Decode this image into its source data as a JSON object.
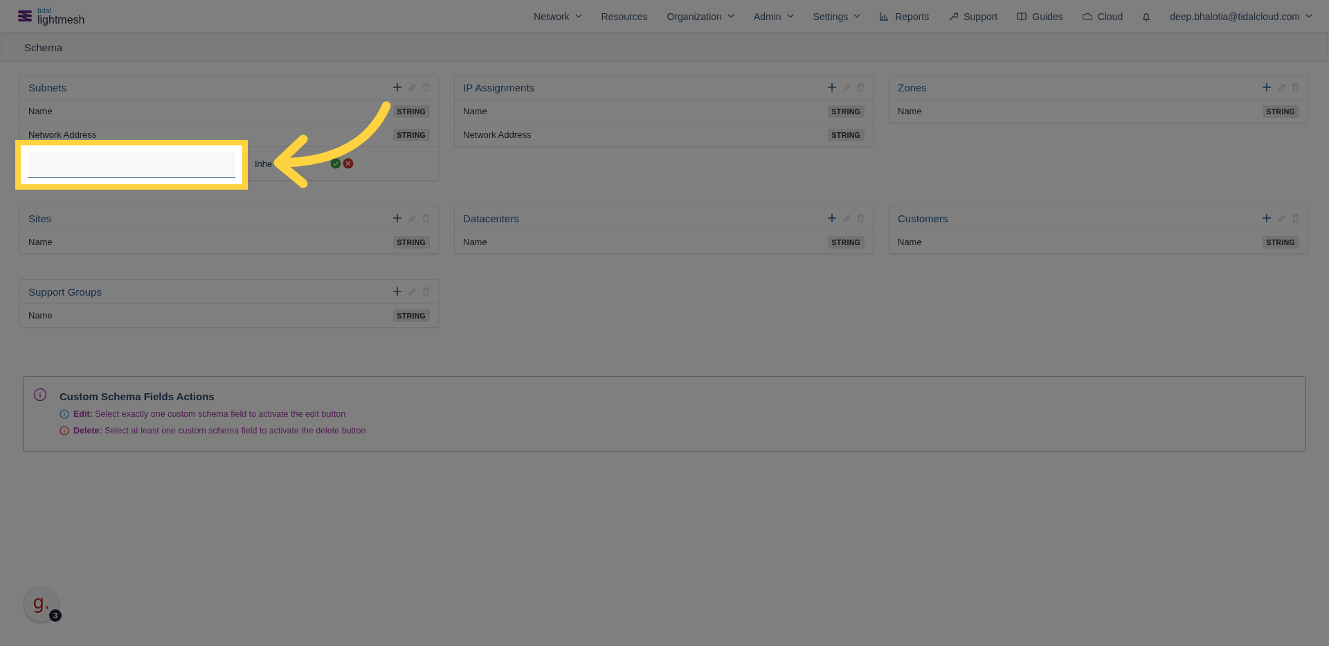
{
  "logo": {
    "small": "tidal",
    "name": "lightmesh"
  },
  "nav": [
    {
      "label": "Network",
      "kind": "dropdown"
    },
    {
      "label": "Resources",
      "kind": "link"
    },
    {
      "label": "Organization",
      "kind": "dropdown"
    },
    {
      "label": "Admin",
      "kind": "dropdown"
    },
    {
      "label": "Settings",
      "kind": "dropdown"
    },
    {
      "label": "Reports",
      "kind": "chart"
    },
    {
      "label": "Support",
      "kind": "wrench"
    },
    {
      "label": "Guides",
      "kind": "book"
    },
    {
      "label": "Cloud",
      "kind": "cloud"
    }
  ],
  "user": "deep.bhalotia@tidalcloud.com",
  "page_title": "Schema",
  "cards": [
    {
      "title": "Subnets",
      "fields": [
        {
          "name": "Name",
          "type": "STRING"
        },
        {
          "name": "Network Address",
          "type": "STRING"
        }
      ],
      "new_field": {
        "inherit_label": "Inhe"
      }
    },
    {
      "title": "IP Assignments",
      "fields": [
        {
          "name": "Name",
          "type": "STRING"
        },
        {
          "name": "Network Address",
          "type": "STRING"
        }
      ]
    },
    {
      "title": "Zones",
      "fields": [
        {
          "name": "Name",
          "type": "STRING"
        }
      ]
    },
    {
      "title": "Sites",
      "fields": [
        {
          "name": "Name",
          "type": "STRING"
        }
      ]
    },
    {
      "title": "Datacenters",
      "fields": [
        {
          "name": "Name",
          "type": "STRING"
        }
      ]
    },
    {
      "title": "Customers",
      "fields": [
        {
          "name": "Name",
          "type": "STRING"
        }
      ]
    },
    {
      "title": "Support Groups",
      "fields": [
        {
          "name": "Name",
          "type": "STRING"
        }
      ]
    }
  ],
  "info": {
    "title": "Custom Schema Fields Actions",
    "items": [
      {
        "kind": "edit",
        "label": "Edit:",
        "text": "Select exactly one custom schema field to activate the edit button"
      },
      {
        "kind": "delete",
        "label": "Delete:",
        "text": "Select at least one custom schema field to activate the delete button"
      }
    ]
  },
  "help_bubble": {
    "letter": "g.",
    "count": "3"
  }
}
